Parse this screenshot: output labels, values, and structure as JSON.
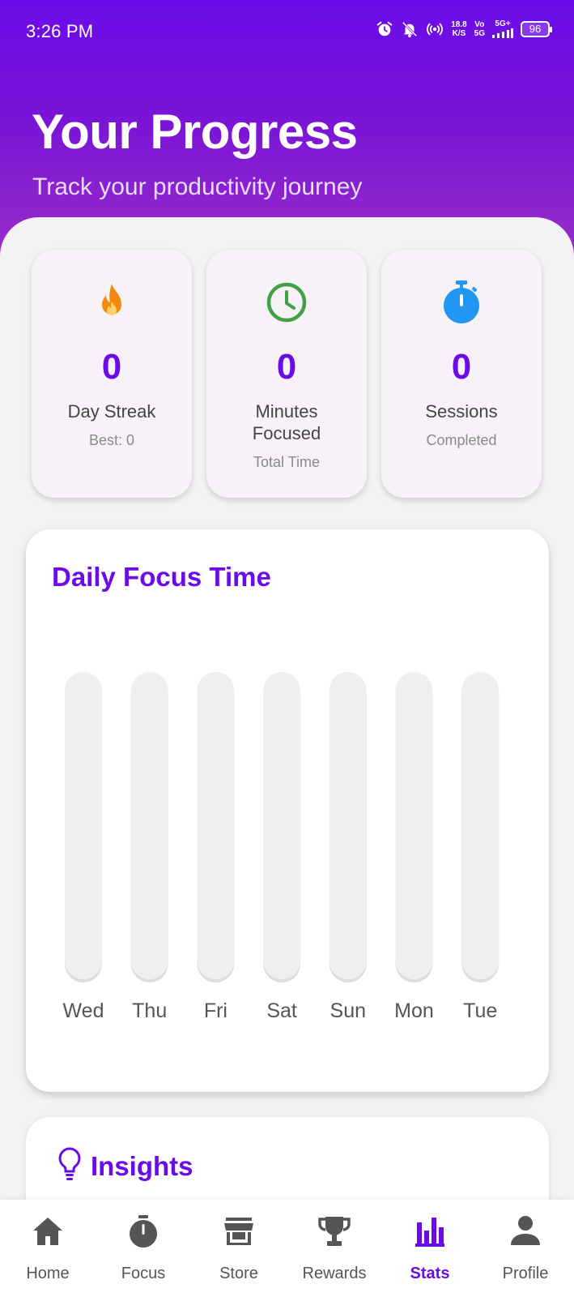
{
  "status_bar": {
    "time": "3:26 PM",
    "net_speed_top": "18.8",
    "net_speed_bottom": "K/S",
    "volte_top": "Vo",
    "volte_bottom": "5G",
    "signal_label": "5G+",
    "battery": "96",
    "icons": [
      "alarm-icon",
      "bell-muted-icon",
      "hotspot-icon",
      "signal-icon",
      "battery-icon"
    ]
  },
  "header": {
    "title": "Your Progress",
    "subtitle": "Track your productivity journey"
  },
  "stats": [
    {
      "icon": "flame-icon",
      "icon_color": "#f28a0f",
      "value": "0",
      "label": "Day Streak",
      "sub": "Best: 0"
    },
    {
      "icon": "clock-icon",
      "icon_color": "#43a047",
      "value": "0",
      "label_line1": "Minutes",
      "label_line2": "Focused",
      "sub": "Total Time"
    },
    {
      "icon": "stopwatch-icon",
      "icon_color": "#2196f3",
      "value": "0",
      "label": "Sessions",
      "sub": "Completed"
    }
  ],
  "daily_focus": {
    "title": "Daily Focus Time"
  },
  "chart_data": {
    "type": "bar",
    "categories": [
      "Wed",
      "Thu",
      "Fri",
      "Sat",
      "Sun",
      "Mon",
      "Tue"
    ],
    "values": [
      0,
      0,
      0,
      0,
      0,
      0,
      0
    ],
    "title": "Daily Focus Time",
    "xlabel": "",
    "ylabel": "",
    "grid": false
  },
  "insights": {
    "title": "Insights",
    "icon": "lightbulb-icon"
  },
  "nav": {
    "items": [
      {
        "label": "Home",
        "icon": "home-icon",
        "active": false
      },
      {
        "label": "Focus",
        "icon": "timer-icon",
        "active": false
      },
      {
        "label": "Store",
        "icon": "store-icon",
        "active": false
      },
      {
        "label": "Rewards",
        "icon": "trophy-icon",
        "active": false
      },
      {
        "label": "Stats",
        "icon": "bar-chart-icon",
        "active": true
      },
      {
        "label": "Profile",
        "icon": "person-icon",
        "active": false
      }
    ]
  },
  "colors": {
    "accent": "#6a0ce8",
    "header_top": "#6a0ce8",
    "header_bottom": "#9a30c8",
    "bar_track": "#efefef",
    "inactive_nav": "#555555"
  }
}
